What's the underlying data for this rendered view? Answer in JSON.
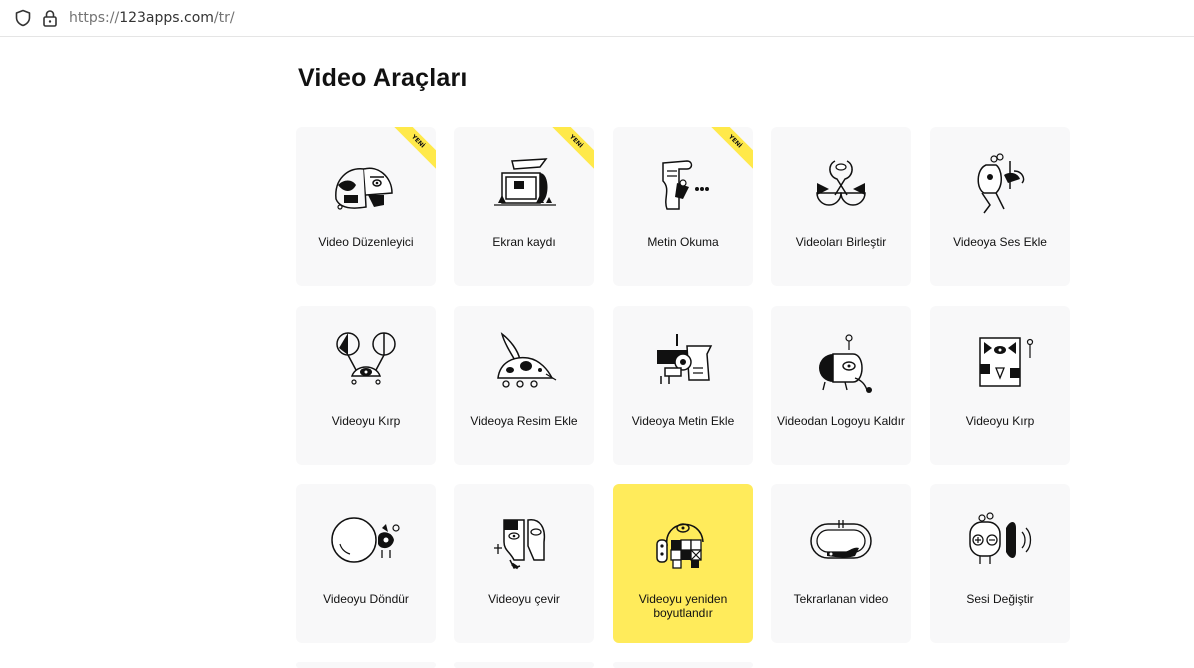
{
  "browser": {
    "url_prefix": "https://",
    "url_host": "123apps.com",
    "url_path": "/tr/"
  },
  "page": {
    "title": "Video Araçları"
  },
  "badge_text": "YENİ",
  "tools": [
    {
      "label": "Video Düzenleyici",
      "icon": "chameleon-icon",
      "new": true
    },
    {
      "label": "Ekran kaydı",
      "icon": "screen-recorder-icon",
      "new": true
    },
    {
      "label": "Metin Okuma",
      "icon": "text-to-speech-icon",
      "new": true
    },
    {
      "label": "Videoları Birleştir",
      "icon": "merge-videos-icon",
      "new": false
    },
    {
      "label": "Videoya Ses Ekle",
      "icon": "add-audio-icon",
      "new": false
    },
    {
      "label": "Videoyu Kırp",
      "icon": "crop-crab-icon",
      "new": false
    },
    {
      "label": "Videoya Resim Ekle",
      "icon": "add-image-icon",
      "new": false
    },
    {
      "label": "Videoya Metin Ekle",
      "icon": "add-text-icon",
      "new": false
    },
    {
      "label": "Videodan Logoyu Kaldır",
      "icon": "remove-logo-icon",
      "new": false
    },
    {
      "label": "Videoyu Kırp",
      "icon": "trim-video-icon",
      "new": false
    },
    {
      "label": "Videoyu Döndür",
      "icon": "rotate-video-icon",
      "new": false
    },
    {
      "label": "Videoyu çevir",
      "icon": "flip-video-icon",
      "new": false
    },
    {
      "label": "Videoyu yeniden boyutlandır",
      "icon": "resize-video-icon",
      "new": false,
      "highlighted": true
    },
    {
      "label": "Tekrarlanan video",
      "icon": "loop-video-icon",
      "new": false
    },
    {
      "label": "Sesi Değiştir",
      "icon": "change-voice-icon",
      "new": false
    }
  ],
  "colors": {
    "card_bg": "#f8f8f9",
    "highlight": "#ffeb5b",
    "ribbon": "#ffe94a"
  }
}
